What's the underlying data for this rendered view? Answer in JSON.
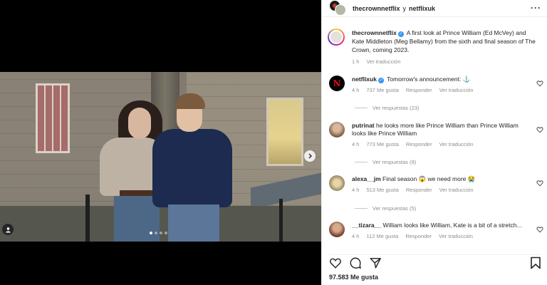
{
  "post": {
    "header": {
      "account": "thecrownnetflix",
      "joiner": "y",
      "coauthor": "netflixuk",
      "more_icon": "more-horizontal-icon"
    },
    "caption": {
      "username": "thecrownnetflix",
      "text": "A first look at Prince William (Ed McVey) and Kate Middleton (Meg Bellamy) from the sixth and final season of The Crown, coming 2023.",
      "time": "1 h",
      "translate": "Ver traducción"
    },
    "comments": [
      {
        "username": "netflixuk",
        "verified": true,
        "text": "Tomorrow's announcement: ⚓",
        "time": "4 h",
        "likes": "737 Me gusta",
        "reply": "Responder",
        "translate": "Ver traducción",
        "replies": "Ver respuestas (23)"
      },
      {
        "username": "putrinat",
        "text": "he looks more like Prince William than Prince William looks like Prince William",
        "time": "4 h",
        "likes": "773 Me gusta",
        "reply": "Responder",
        "translate": "Ver traducción",
        "replies": "Ver respuestas (9)"
      },
      {
        "username": "alexa__jm",
        "text": "Final season 😱 we need more 😭",
        "time": "4 h",
        "likes": "513 Me gusta",
        "reply": "Responder",
        "translate": "Ver traducción",
        "replies": "Ver respuestas (5)"
      },
      {
        "username": "__tizara__",
        "text": "William looks like William, Kate is a bit of a stretch...",
        "time": "4 h",
        "likes": "112 Me gusta",
        "reply": "Responder",
        "translate": "Ver traducción"
      }
    ],
    "likes": "97.583 Me gusta",
    "carousel": {
      "total": 4,
      "active": 1
    }
  },
  "colors": {
    "verified": "#3897f0",
    "secondary_text": "#8e8e8e",
    "netflix_red": "#e50914"
  }
}
